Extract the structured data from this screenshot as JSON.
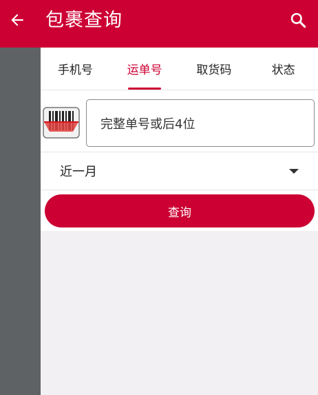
{
  "header": {
    "title": "包裹查询",
    "back_icon": "arrow-left-icon",
    "search_icon": "search-icon",
    "bg_color": "#cc0033"
  },
  "tabs": [
    {
      "label": "手机号",
      "active": false
    },
    {
      "label": "运单号",
      "active": true
    },
    {
      "label": "取货码",
      "active": false
    },
    {
      "label": "状态",
      "active": false
    }
  ],
  "form": {
    "scan_icon": "barcode-scan-icon",
    "tracking_placeholder": "完整单号或后4位",
    "tracking_value": "",
    "time_range": "近一月",
    "submit_label": "查询"
  }
}
